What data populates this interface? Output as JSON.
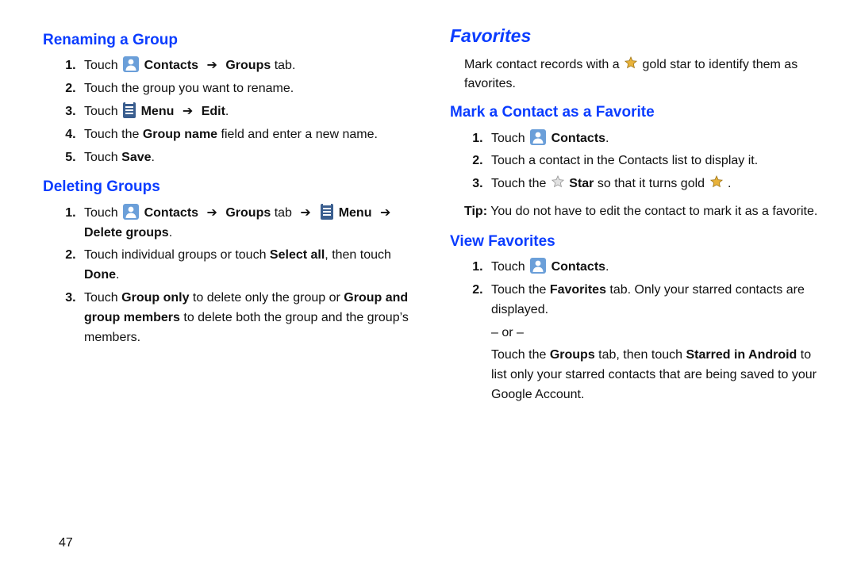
{
  "page_number": "47",
  "left": {
    "h_rename": "Renaming a Group",
    "rename_steps": {
      "s1_a": "Touch ",
      "s1_contacts": "Contacts",
      "s1_b": "Groups",
      "s1_c": " tab.",
      "s2": "Touch the group you want to rename.",
      "s3_a": "Touch ",
      "s3_menu": "Menu",
      "s3_edit": "Edit",
      "s3_dot": ".",
      "s4_a": "Touch the ",
      "s4_b": "Group name",
      "s4_c": " field and enter a new name.",
      "s5_a": "Touch ",
      "s5_b": "Save",
      "s5_c": "."
    },
    "h_delete": "Deleting Groups",
    "delete_steps": {
      "s1_a": "Touch ",
      "s1_contacts": "Contacts",
      "s1_groups": "Groups",
      "s1_tab": " tab ",
      "s1_menu": "Menu",
      "s1_delgroups": "Delete groups",
      "s1_dot": ".",
      "s2_a": "Touch individual groups or touch ",
      "s2_b": "Select all",
      "s2_c": ", then touch ",
      "s2_d": "Done",
      "s2_e": ".",
      "s3_a": "Touch ",
      "s3_b": "Group only",
      "s3_c": " to delete only the group or ",
      "s3_d": "Group and group members",
      "s3_e": " to delete both the group and the group’s members."
    }
  },
  "right": {
    "h_fav": "Favorites",
    "intro_a": "Mark contact records with a ",
    "intro_b": " gold star to identify them as favorites.",
    "h_mark": "Mark a Contact as a Favorite",
    "mark_steps": {
      "s1_a": "Touch ",
      "s1_b": "Contacts",
      "s1_c": ".",
      "s2": "Touch a contact in the Contacts list to display it.",
      "s3_a": "Touch the ",
      "s3_b": "Star",
      "s3_c": " so that it turns gold ",
      "s3_d": "."
    },
    "tip_label": "Tip:",
    "tip_body": " You do not have to edit the contact to mark it as a favorite.",
    "h_view": "View Favorites",
    "view_steps": {
      "s1_a": "Touch ",
      "s1_b": "Contacts",
      "s1_c": ".",
      "s2_a": "Touch the ",
      "s2_b": "Favorites",
      "s2_c": " tab. Only your starred contacts are displayed.",
      "or": "– or –",
      "s2_d": "Touch the ",
      "s2_e": "Groups",
      "s2_f": " tab, then touch ",
      "s2_g": "Starred in Android",
      "s2_h": " to list only your starred contacts that are being saved to your Google Account."
    }
  },
  "arrow": "➔"
}
